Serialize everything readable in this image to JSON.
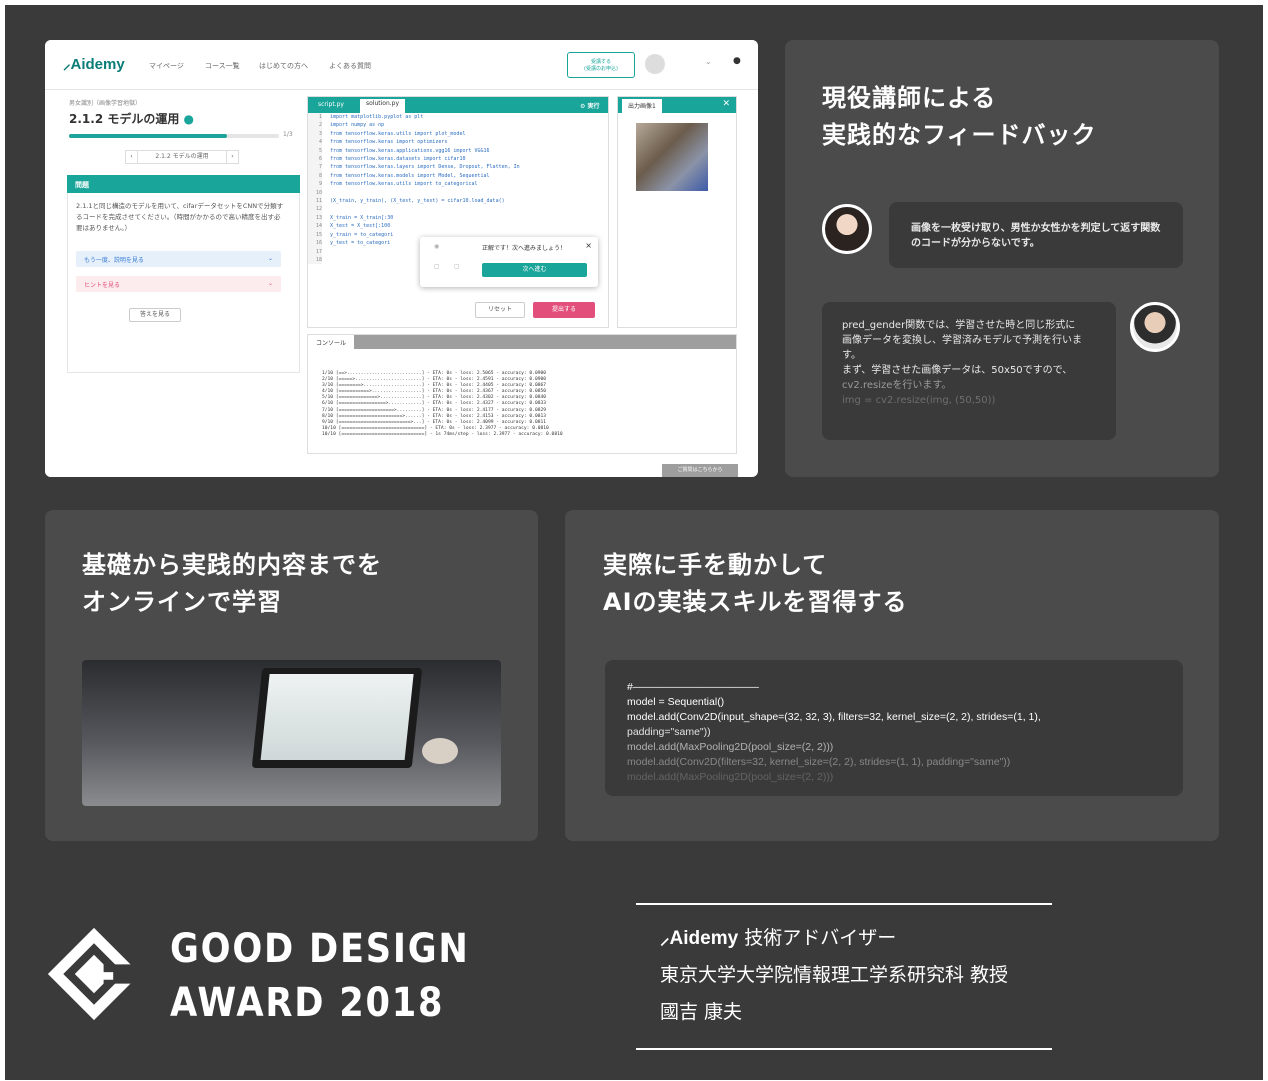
{
  "screenshot": {
    "logo": "Aidemy",
    "nav": [
      "マイページ",
      "コース一覧",
      "はじめての方へ",
      "よくある質問"
    ],
    "nav_button": [
      "受講する",
      "(受講のお申込)"
    ],
    "breadcrumb": "男女識別（画像学習地獄）",
    "exercise_title": "2.1.2 モデルの運用",
    "progress": 0.75,
    "progress_label": "1/3",
    "pager_label": "2.1.2 モデルの運用",
    "question_header": "問題",
    "question_text": "2.1.1と同じ構造のモデルを用いて、cifarデータセットをCNNで分類するコードを完成させてください。（時間がかかるので高い精度を出す必要はありません。）",
    "hint_explain": "もう一度、説明を見る",
    "hint": "ヒントを見る",
    "answer_button": "答えを見る",
    "editor_tabs": [
      "script.py",
      "solution.py"
    ],
    "run_label": "実行",
    "code_lines": [
      "import matplotlib.pyplot as plt",
      "import numpy as np",
      "from tensorflow.keras.utils import plot_model",
      "from tensorflow.keras import optimizers",
      "from tensorflow.keras.applications.vgg16 import VGG16",
      "from tensorflow.keras.datasets import cifar10",
      "from tensorflow.keras.layers import Dense, Dropout, Flatten, In",
      "from tensorflow.keras.models import Model, Sequential",
      "from tensorflow.keras.utils import to_categorical",
      "",
      "(X_train, y_train), (X_test, y_test) = cifar10.load_data()",
      "",
      "X_train = X_train[:30",
      "X_test = X_test[:100",
      "y_train = to_categori",
      "y_test = to_categori",
      "",
      ""
    ],
    "popup_text": "正解です！次へ進みましょう！",
    "popup_next": "次へ進む",
    "reset_label": "リセット",
    "submit_label": "提出する",
    "output_tab": "出力画像1",
    "console_tab": "コンソール",
    "console_log": [
      "1/10 [==>...........................] - ETA: 0s - loss: 2.5065 - accuracy: 0.0900",
      "2/10 [=====>........................] - ETA: 0s - loss: 2.4591 - accuracy: 0.0900",
      "3/10 [========>.....................] - ETA: 0s - loss: 2.4405 - accuracy: 0.0867",
      "4/10 [===========>..................] - ETA: 0s - loss: 2.4367 - accuracy: 0.0850",
      "5/10 [==============>...............] - ETA: 0s - loss: 2.4302 - accuracy: 0.0840",
      "6/10 [=================>............] - ETA: 0s - loss: 2.4327 - accuracy: 0.0833",
      "7/10 [====================>.........] - ETA: 0s - loss: 2.4177 - accuracy: 0.0829",
      "8/10 [=======================>......] - ETA: 0s - loss: 2.4153 - accuracy: 0.0813",
      "9/10 [==========================>...] - ETA: 0s - loss: 2.4099 - accuracy: 0.0811",
      "10/10 [==============================] - ETA: 0s - loss: 2.3977 - accuracy: 0.0810",
      "10/10 [==============================] - 1s 74ms/step - loss: 2.3977 - accuracy: 0.0810"
    ],
    "question_button": "ご質問はこちらから"
  },
  "feedback": {
    "heading": [
      "現役講師による",
      "実践的なフィードバック"
    ],
    "user_message": "画像を一枚受け取り、男性か女性かを判定して返す関数のコードが分からないです。",
    "mentor_message": [
      "pred_gender関数では、学習させた時と同じ形式に",
      "画像データを変換し、学習済みモデルで予測を行いま",
      "す。",
      "まず、学習させた画像データは、50x50ですので、",
      "cv2.resizeを行います。",
      "img = cv2.resize(img, (50,50))"
    ]
  },
  "online": {
    "heading": [
      "基礎から実践的内容までを",
      "オンラインで学習"
    ]
  },
  "handson": {
    "heading": [
      "実際に手を動かして",
      "AIの実装スキルを習得する"
    ],
    "code_lines": [
      "#————————————",
      "model = Sequential()",
      "model.add(Conv2D(input_shape=(32, 32, 3), filters=32, kernel_size=(2, 2), strides=(1, 1),",
      "padding=\"same\"))",
      "model.add(MaxPooling2D(pool_size=(2, 2)))",
      "model.add(Conv2D(filters=32, kernel_size=(2, 2), strides=(1, 1), padding=\"same\"))",
      "model.add(MaxPooling2D(pool_size=(2, 2)))"
    ]
  },
  "award": {
    "line1": "GOOD DESIGN",
    "line2": "AWARD 2018"
  },
  "advisor": {
    "logo": "Aidemy",
    "role": "技術アドバイザー",
    "affiliation": "東京大学大学院情報理工学系研究科 教授",
    "name": "國吉 康夫"
  },
  "colors": {
    "background": "#3a3a3a",
    "panel": "#4b4b4b",
    "brand_teal": "#1aa59a",
    "submit_pink": "#e24f7a"
  }
}
